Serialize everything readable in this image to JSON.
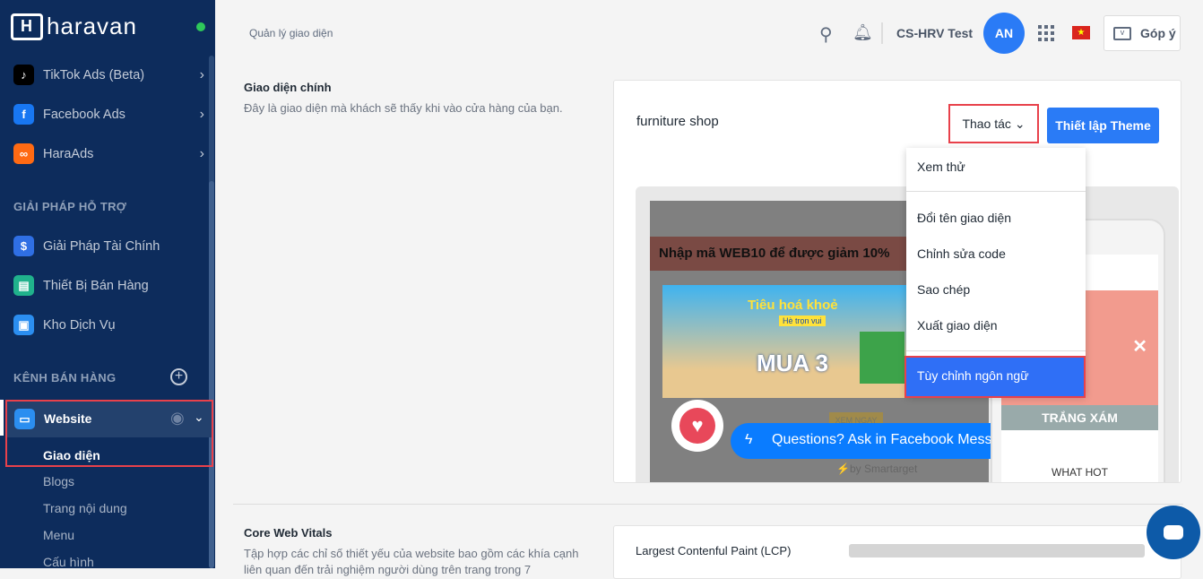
{
  "brand": {
    "name": "haravan"
  },
  "sidebar": {
    "items": [
      {
        "label": "TikTok Ads (Beta)",
        "icon": "tiktok-icon",
        "color": "#000000"
      },
      {
        "label": "Facebook Ads",
        "icon": "facebook-icon",
        "color": "#1877f2"
      },
      {
        "label": "HaraAds",
        "icon": "haraads-icon",
        "color": "#ff6a13"
      }
    ],
    "support_title": "GIẢI PHÁP HỖ TRỢ",
    "support": [
      {
        "label": "Giải Pháp Tài Chính",
        "color": "#2f6fe4"
      },
      {
        "label": "Thiết Bị Bán Hàng",
        "color": "#20b28c"
      },
      {
        "label": "Kho Dịch Vụ",
        "color": "#2b8ef0"
      }
    ],
    "channels_title": "KÊNH BÁN HÀNG",
    "website": "Website",
    "subitems": [
      "Giao diện",
      "Blogs",
      "Trang nội dung",
      "Menu",
      "Cấu hình"
    ]
  },
  "breadcrumb": "Quản lý giao diện",
  "header": {
    "store": "CS-HRV Test",
    "avatar": "AN",
    "feedback": "Góp ý"
  },
  "main_theme": {
    "title": "Giao diện chính",
    "desc": "Đây là giao diện mà khách sẽ thấy khi vào cửa hàng của bạn.",
    "theme_name": "furniture shop",
    "actions_label": "Thao tác",
    "setup_label": "Thiết lập Theme"
  },
  "menu": [
    "Xem thử",
    "Đổi tên giao diện",
    "Chỉnh sửa code",
    "Sao chép",
    "Xuất giao diện",
    "Tùy chỉnh ngôn ngữ"
  ],
  "preview": {
    "promo": "Nhập mã WEB10 để được giảm 10%",
    "banner_title": "Tiêu hoá khoẻ",
    "banner_sub": "Hè trọn vui",
    "banner_big": "MUA 3",
    "messenger": "Questions? Ask in Facebook Mess",
    "view_now": "XEM NGAY",
    "powered": "by Smartarget",
    "mobile_hot": "WHAT HOT",
    "mobile_banner": "TRẮNG XÁM"
  },
  "cwv": {
    "title": "Core Web Vitals",
    "desc": "Tập hợp các chỉ số thiết yếu của website bao gồm các khía cạnh liên quan đến trải nghiệm người dùng trên trang trong 7",
    "lcp": "Largest Contenful Paint (LCP)"
  }
}
